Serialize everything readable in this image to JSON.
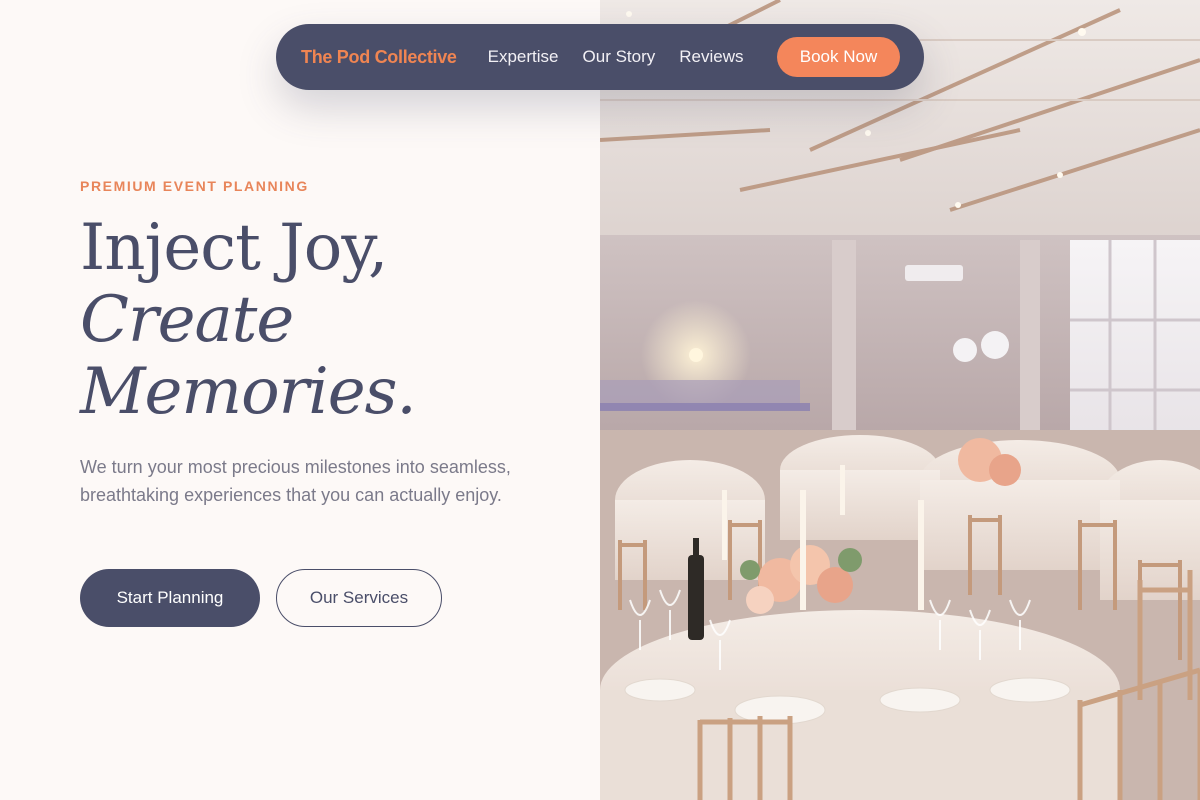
{
  "nav": {
    "brand": "The Pod Collective",
    "links": [
      {
        "label": "Expertise"
      },
      {
        "label": "Our Story"
      },
      {
        "label": "Reviews"
      }
    ],
    "cta": "Book Now"
  },
  "hero": {
    "eyebrow": "PREMIUM EVENT PLANNING",
    "headline_line1": "Inject Joy,",
    "headline_line2": "Create",
    "headline_line3": "Memories.",
    "lede": "We turn your most precious milestones into seamless, breathtaking experiences that you can actually enjoy.",
    "primary_cta": "Start Planning",
    "secondary_cta": "Our Services"
  },
  "image": {
    "subject": "banquet-hall-photo"
  },
  "colors": {
    "navy": "#4a4e69",
    "accent": "#f4865b",
    "background": "#fdf9f7"
  }
}
